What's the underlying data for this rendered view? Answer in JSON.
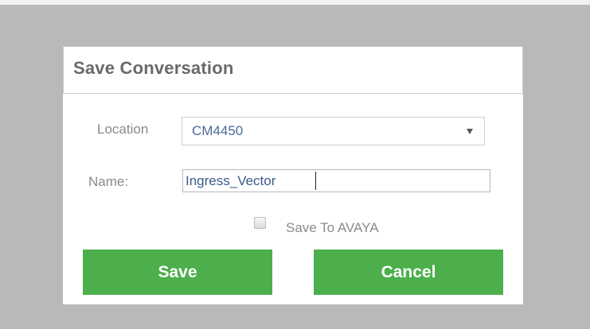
{
  "dialog": {
    "title": "Save Conversation",
    "location": {
      "label": "Location",
      "selected": "CM4450"
    },
    "name": {
      "label": "Name:",
      "value": "Ingress_Vector"
    },
    "save_to_avaya": {
      "label": "Save To AVAYA",
      "checked": false
    },
    "buttons": {
      "save": "Save",
      "cancel": "Cancel"
    }
  },
  "colors": {
    "button_green": "#4caf4c",
    "backdrop": "#b9b9b9",
    "title_text": "#6a6a6a"
  },
  "icons": {
    "dropdown": "chevron-down-icon"
  }
}
